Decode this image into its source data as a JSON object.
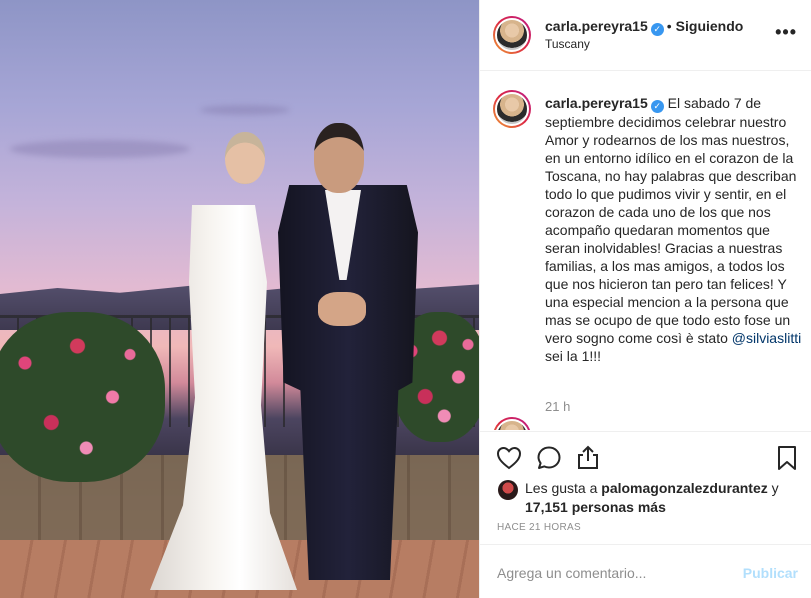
{
  "post": {
    "username": "carla.pereyra15",
    "verified": true,
    "follow_status": "Siguiendo",
    "location": "Tuscany",
    "more_label": "•••"
  },
  "caption": {
    "username": "carla.pereyra15",
    "text_before_mention": "El sabado 7 de septiembre decidimos celebrar nuestro Amor y rodearnos de los mas nuestros, en un entorno idílico en el corazon de la Toscana, no hay palabras que describan todo lo que pudimos vivir y sentir, en el corazon de cada uno de los que nos acompaño quedaran momentos que seran inolvidables! Gracias a nuestras familias, a los mas amigos, a todos los que nos hicieron tan pero tan felices! Y una especial mencion a la persona que mas se ocupo de que todo esto fose un vero sogno come così è stato ",
    "mention": "@silviaslitti",
    "text_after_mention": " sei la 1!!!",
    "time": "21 h"
  },
  "likes": {
    "prefix": "Les gusta a ",
    "first_user": "palomagonzalezdurantez",
    "joiner": " y ",
    "others_count": "17,151 personas más"
  },
  "timestamp": "HACE 21 HORAS",
  "comment_form": {
    "placeholder": "Agrega un comentario...",
    "publish_label": "Publicar"
  },
  "colors": {
    "verified_blue": "#3897f0",
    "publish_disabled": "#b2dffc",
    "mention": "#003569"
  }
}
